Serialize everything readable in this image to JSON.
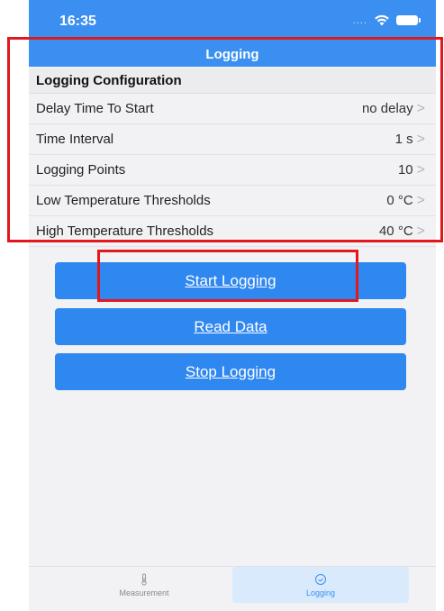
{
  "status_bar": {
    "time": "16:35",
    "signal": "...."
  },
  "nav": {
    "title": "Logging"
  },
  "section": {
    "title": "Logging Configuration"
  },
  "settings": [
    {
      "label": "Delay Time To Start",
      "value": "no delay"
    },
    {
      "label": "Time Interval",
      "value": "1 s"
    },
    {
      "label": "Logging Points",
      "value": "10"
    },
    {
      "label": "Low Temperature Thresholds",
      "value": "0 °C"
    },
    {
      "label": "High Temperature Thresholds",
      "value": "40 °C"
    }
  ],
  "chevron": ">",
  "buttons": {
    "start": "Start Logging",
    "read": "Read Data",
    "stop": "Stop Logging"
  },
  "tabs": [
    {
      "label": "Measurement",
      "icon": "thermometer-icon",
      "active": false
    },
    {
      "label": "Logging",
      "icon": "clock-icon",
      "active": true
    }
  ],
  "colors": {
    "primary": "#3b8ff0",
    "button": "#2f87f0",
    "highlight": "#e1191e",
    "background": "#f2f2f4"
  }
}
